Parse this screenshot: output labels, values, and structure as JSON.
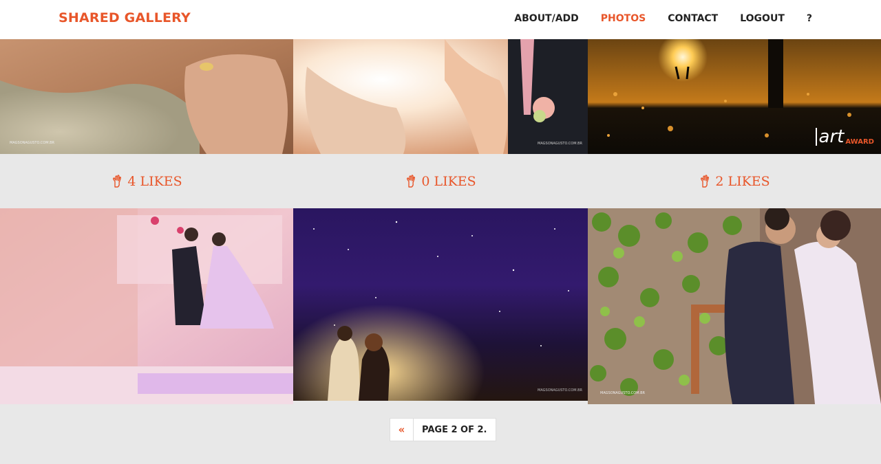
{
  "nav": {
    "brand": "SHARED GALLERY",
    "links": [
      {
        "label": "ABOUT/ADD",
        "active": false
      },
      {
        "label": "PHOTOS",
        "active": true
      },
      {
        "label": "CONTACT",
        "active": false
      },
      {
        "label": "LOGOUT",
        "active": false
      },
      {
        "label": "?",
        "active": false
      }
    ]
  },
  "photos": [
    {
      "likes_label": "4 LIKES"
    },
    {
      "likes_label": "0 LIKES"
    },
    {
      "likes_label": "2 LIKES"
    }
  ],
  "badge": {
    "art": "art",
    "award": "AWARD"
  },
  "pagination": {
    "prev": "«",
    "info": "PAGE 2 OF 2."
  },
  "colors": {
    "accent": "#e8562a",
    "background": "#e8e8e8",
    "text": "#222222"
  }
}
